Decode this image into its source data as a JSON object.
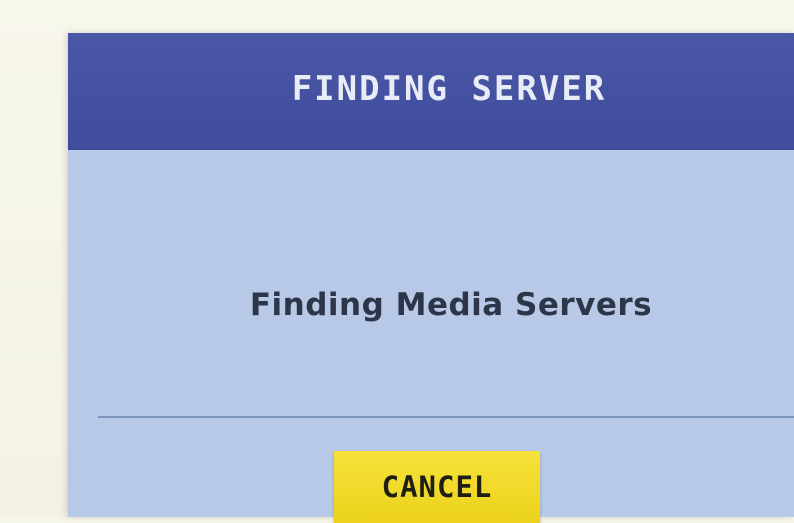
{
  "dialog": {
    "title": "FINDING SERVER",
    "message": "Finding Media Servers",
    "cancel_label": "CANCEL"
  },
  "colors": {
    "title_bar": "#4450a0",
    "dialog_body": "#b8c9e8",
    "button": "#f0d829",
    "background": "#f6f5e9"
  }
}
